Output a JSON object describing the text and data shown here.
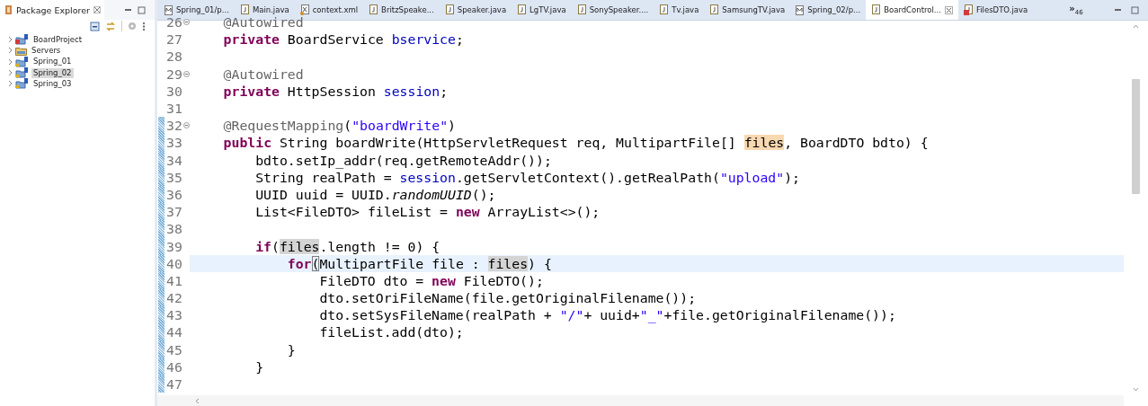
{
  "explorer": {
    "title": "Package Explorer",
    "items": [
      {
        "label": "BoardProject",
        "kind": "project-error",
        "selected": false
      },
      {
        "label": "Servers",
        "kind": "folder",
        "selected": false
      },
      {
        "label": "Spring_01",
        "kind": "project-warning",
        "selected": false
      },
      {
        "label": "Spring_02",
        "kind": "project-warning",
        "selected": true
      },
      {
        "label": "Spring_03",
        "kind": "project-warning",
        "selected": false
      }
    ]
  },
  "tabs": [
    {
      "label": "Spring_01/p...",
      "kind": "manifest",
      "selected": false
    },
    {
      "label": "Main.java",
      "kind": "java",
      "selected": false
    },
    {
      "label": "context.xml",
      "kind": "xml",
      "selected": false
    },
    {
      "label": "BritzSpeake...",
      "kind": "java",
      "selected": false
    },
    {
      "label": "Speaker.java",
      "kind": "java",
      "selected": false
    },
    {
      "label": "LgTV.java",
      "kind": "java",
      "selected": false
    },
    {
      "label": "SonySpeaker....",
      "kind": "java",
      "selected": false
    },
    {
      "label": "Tv.java",
      "kind": "java",
      "selected": false
    },
    {
      "label": "SamsungTV.java",
      "kind": "java",
      "selected": false
    },
    {
      "label": "Spring_02/p...",
      "kind": "manifest",
      "selected": false
    },
    {
      "label": "BoardControl...",
      "kind": "java",
      "selected": true
    },
    {
      "label": "FilesDTO.java",
      "kind": "java-error",
      "selected": false
    }
  ],
  "tab_overflow": {
    "symbol": "»",
    "count": "46"
  },
  "code": [
    {
      "n": "26",
      "fold": true,
      "changed": false,
      "current": false,
      "tokens": [
        {
          "kind": "ann",
          "text": "@Autowired"
        }
      ]
    },
    {
      "n": "27",
      "fold": false,
      "changed": false,
      "current": false,
      "tokens": [
        {
          "kind": "kw",
          "text": "private"
        },
        {
          "kind": "plain",
          "text": " BoardService "
        },
        {
          "kind": "field",
          "text": "bservice"
        },
        {
          "kind": "plain",
          "text": ";"
        }
      ]
    },
    {
      "n": "28",
      "fold": false,
      "changed": false,
      "current": false
    },
    {
      "n": "29",
      "fold": true,
      "changed": false,
      "current": false,
      "tokens": [
        {
          "kind": "ann",
          "text": "@Autowired"
        }
      ]
    },
    {
      "n": "30",
      "fold": false,
      "changed": false,
      "current": false,
      "tokens": [
        {
          "kind": "kw",
          "text": "private"
        },
        {
          "kind": "plain",
          "text": " HttpSession "
        },
        {
          "kind": "field",
          "text": "session"
        },
        {
          "kind": "plain",
          "text": ";"
        }
      ]
    },
    {
      "n": "31",
      "fold": false,
      "changed": false,
      "current": false
    },
    {
      "n": "32",
      "fold": true,
      "changed": true,
      "current": false,
      "tokens": [
        {
          "kind": "ann",
          "text": "@RequestMapping"
        },
        {
          "kind": "plain",
          "text": "("
        },
        {
          "kind": "str",
          "text": "\"boardWrite\""
        },
        {
          "kind": "plain",
          "text": ")"
        }
      ]
    },
    {
      "n": "33",
      "fold": false,
      "changed": true,
      "current": false,
      "tokens": [
        {
          "kind": "kw",
          "text": "public"
        },
        {
          "kind": "plain",
          "text": " String boardWrite(HttpServletRequest req, MultipartFile[] "
        },
        {
          "kind": "decl",
          "text": "files"
        },
        {
          "kind": "plain",
          "text": ", BoardDTO bdto) {"
        }
      ],
      "children": [
        {
          "n": "34",
          "fold": false,
          "changed": true,
          "current": false,
          "tokens": [
            {
              "kind": "plain",
              "text": "bdto.setIp_addr(req.getRemoteAddr());"
            }
          ]
        },
        {
          "n": "35",
          "fold": false,
          "changed": true,
          "current": false,
          "tokens": [
            {
              "kind": "plain",
              "text": "String realPath = "
            },
            {
              "kind": "field",
              "text": "session"
            },
            {
              "kind": "plain",
              "text": ".getServletContext().getRealPath("
            },
            {
              "kind": "str",
              "text": "\"upload\""
            },
            {
              "kind": "plain",
              "text": ");"
            }
          ]
        },
        {
          "n": "36",
          "fold": false,
          "changed": true,
          "current": false,
          "tokens": [
            {
              "kind": "plain",
              "text": "UUID uuid = UUID."
            },
            {
              "kind": "static",
              "text": "randomUUID"
            },
            {
              "kind": "plain",
              "text": "();"
            }
          ]
        },
        {
          "n": "37",
          "fold": false,
          "changed": true,
          "current": false,
          "tokens": [
            {
              "kind": "plain",
              "text": "List<FileDTO> fileList = "
            },
            {
              "kind": "kw",
              "text": "new"
            },
            {
              "kind": "plain",
              "text": " ArrayList<>();"
            }
          ]
        },
        {
          "n": "38",
          "fold": false,
          "changed": true,
          "current": false
        },
        {
          "n": "39",
          "fold": false,
          "changed": true,
          "current": false,
          "tokens": [
            {
              "kind": "kw",
              "text": "if"
            },
            {
              "kind": "plain",
              "text": "("
            },
            {
              "kind": "occ",
              "text": "files"
            },
            {
              "kind": "plain",
              "text": ".length != 0) {"
            }
          ],
          "children": [
            {
              "n": "40",
              "fold": false,
              "changed": true,
              "current": true,
              "tokens": [
                {
                  "kind": "kw",
                  "text": "for"
                },
                {
                  "kind": "bracket",
                  "text": "("
                },
                {
                  "kind": "plain",
                  "text": "MultipartFile file : "
                },
                {
                  "kind": "occ",
                  "text": "files"
                },
                {
                  "kind": "plain",
                  "text": ") {"
                }
              ],
              "children": [
                {
                  "n": "41",
                  "fold": false,
                  "changed": true,
                  "current": false,
                  "tokens": [
                    {
                      "kind": "plain",
                      "text": "FileDTO dto = "
                    },
                    {
                      "kind": "kw",
                      "text": "new"
                    },
                    {
                      "kind": "plain",
                      "text": " FileDTO();"
                    }
                  ]
                },
                {
                  "n": "42",
                  "fold": false,
                  "changed": true,
                  "current": false,
                  "tokens": [
                    {
                      "kind": "plain",
                      "text": "dto.setOriFileName(file.getOriginalFilename());"
                    }
                  ]
                },
                {
                  "n": "43",
                  "fold": false,
                  "changed": true,
                  "current": false,
                  "tokens": [
                    {
                      "kind": "plain",
                      "text": "dto.setSysFileName(realPath + "
                    },
                    {
                      "kind": "str",
                      "text": "\"/\""
                    },
                    {
                      "kind": "plain",
                      "text": "+ uuid+"
                    },
                    {
                      "kind": "str",
                      "text": "\"_\""
                    },
                    {
                      "kind": "plain",
                      "text": "+file.getOriginalFilename());"
                    }
                  ]
                },
                {
                  "n": "44",
                  "fold": false,
                  "changed": true,
                  "current": false,
                  "tokens": [
                    {
                      "kind": "plain",
                      "text": "fileList.add(dto);"
                    }
                  ]
                }
              ]
            },
            {
              "n": "45",
              "fold": false,
              "changed": true,
              "current": false,
              "tokens": [
                {
                  "kind": "plain",
                  "text": "}"
                }
              ]
            }
          ]
        },
        {
          "n": "46",
          "fold": false,
          "changed": true,
          "current": false,
          "tokens": [
            {
              "kind": "plain",
              "text": "}"
            }
          ]
        },
        {
          "n": "47",
          "fold": false,
          "changed": true,
          "current": false
        }
      ]
    }
  ]
}
